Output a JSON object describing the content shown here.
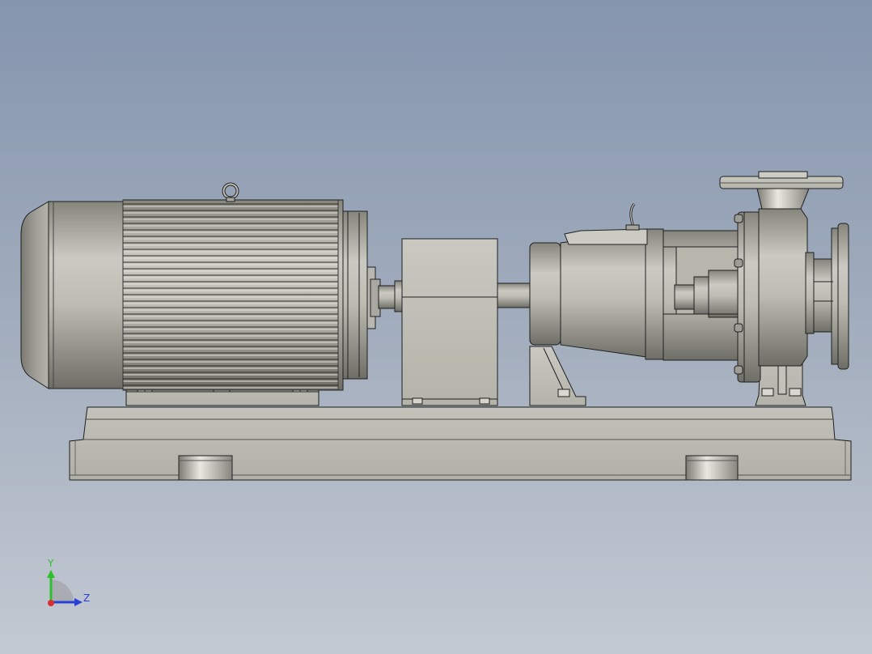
{
  "viewport": {
    "background_top": "#8595ae",
    "background_bottom": "#c3c9d2",
    "model_color": "#bdbdb4",
    "edge_color": "#1f1f1f"
  },
  "model": {
    "parts": [
      "electric-motor",
      "motor-lifting-eye",
      "coupling-guard",
      "bearing-bracket",
      "bracket-lifting-hook",
      "volute-casing",
      "discharge-flange",
      "suction-flange",
      "base-frame"
    ]
  },
  "triad": {
    "y_label": "Y",
    "z_label": "Z",
    "y_color": "#2cc02c",
    "z_color": "#2a3fd6",
    "x_color": "#d83030"
  }
}
